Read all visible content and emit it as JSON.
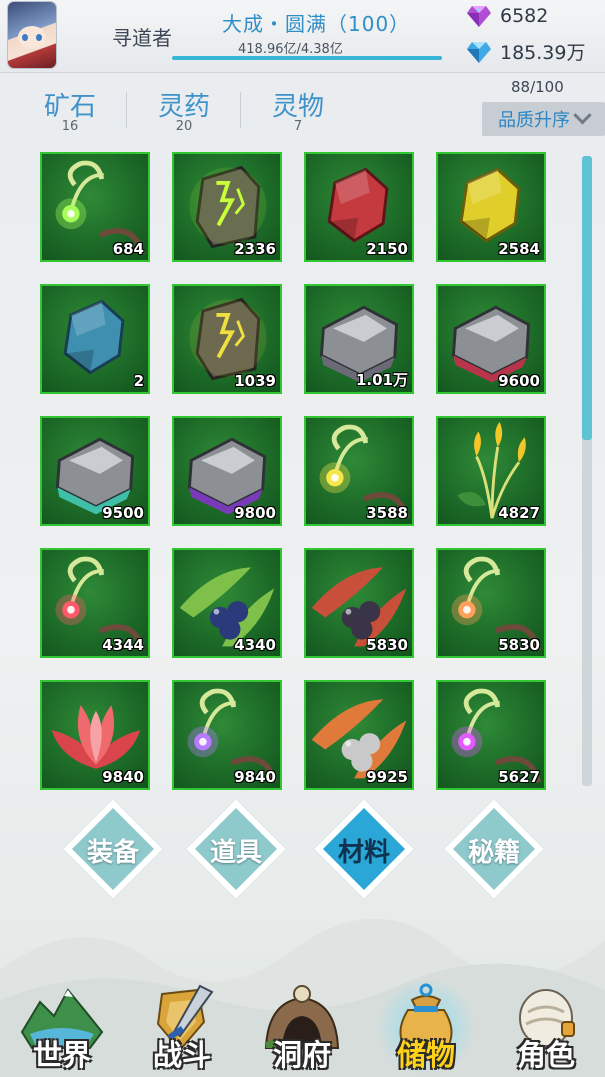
{
  "header": {
    "player_name": "寻道者",
    "realm": "大成・圆满（100）",
    "exp_text": "418.96亿/4.38亿",
    "exp_progress": 1.0,
    "currency": [
      {
        "icon": "purple-gem-icon",
        "value": "6582"
      },
      {
        "icon": "blue-gem-icon",
        "value": "185.39万"
      }
    ]
  },
  "tabs": [
    {
      "label": "矿石",
      "count": "16"
    },
    {
      "label": "灵药",
      "count": "20"
    },
    {
      "label": "灵物",
      "count": "7"
    }
  ],
  "inventory": {
    "capacity": "88/100",
    "sort_label": "品质升序",
    "items": [
      {
        "icon": "glowing-sprout-icon",
        "qty": "684"
      },
      {
        "icon": "lightning-ore-icon",
        "qty": "2336"
      },
      {
        "icon": "red-stone-icon",
        "qty": "2150"
      },
      {
        "icon": "yellow-stone-icon",
        "qty": "2584"
      },
      {
        "icon": "blue-stone-icon",
        "qty": "2"
      },
      {
        "icon": "gold-lightning-ore-icon",
        "qty": "1039"
      },
      {
        "icon": "iron-ore-icon",
        "qty": "1.01万"
      },
      {
        "icon": "red-iron-ore-icon",
        "qty": "9600"
      },
      {
        "icon": "teal-iron-ore-icon",
        "qty": "9500"
      },
      {
        "icon": "purple-iron-ore-icon",
        "qty": "9800"
      },
      {
        "icon": "yellow-sprout-icon",
        "qty": "3588"
      },
      {
        "icon": "golden-flower-plant-icon",
        "qty": "4827"
      },
      {
        "icon": "red-sprout-icon",
        "qty": "4344"
      },
      {
        "icon": "blueberry-herb-icon",
        "qty": "4340"
      },
      {
        "icon": "red-berry-flower-icon",
        "qty": "5830"
      },
      {
        "icon": "orange-sprout-icon",
        "qty": "5830"
      },
      {
        "icon": "red-lotus-icon",
        "qty": "9840"
      },
      {
        "icon": "purple-sprout-icon",
        "qty": "9840"
      },
      {
        "icon": "orange-leaf-berry-icon",
        "qty": "9925"
      },
      {
        "icon": "magenta-sprout-icon",
        "qty": "5627"
      }
    ]
  },
  "categories": [
    {
      "label": "装备",
      "active": false
    },
    {
      "label": "道具",
      "active": false
    },
    {
      "label": "材料",
      "active": true
    },
    {
      "label": "秘籍",
      "active": false
    }
  ],
  "nav": [
    {
      "label": "世界",
      "icon": "world-landscape-icon",
      "active": false
    },
    {
      "label": "战斗",
      "icon": "sword-shield-icon",
      "active": false
    },
    {
      "label": "洞府",
      "icon": "cave-icon",
      "active": false
    },
    {
      "label": "储物",
      "icon": "storage-bag-icon",
      "active": true
    },
    {
      "label": "角色",
      "icon": "character-scroll-icon",
      "active": false
    }
  ],
  "colors": {
    "accent": "#3f93c9",
    "cell_border": "#32c632",
    "active_category": "#2aa7d6",
    "inactive_category": "#8ec9cc",
    "active_nav_label": "#ffd21a"
  }
}
